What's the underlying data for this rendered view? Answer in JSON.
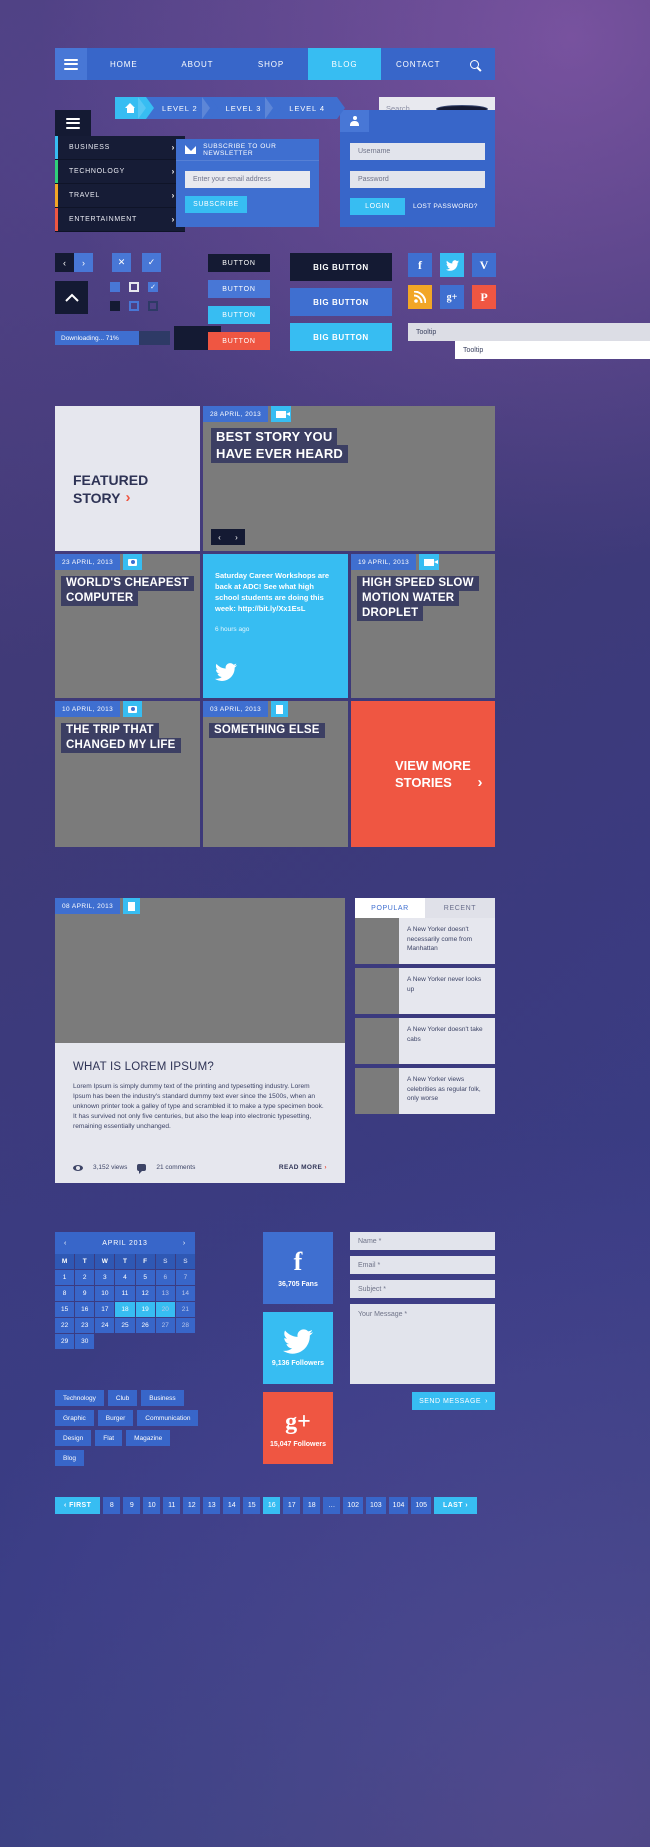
{
  "topnav": {
    "menu_icon": "hamburger-icon",
    "items": [
      {
        "label": "HOME",
        "active": false
      },
      {
        "label": "ABOUT",
        "active": false
      },
      {
        "label": "SHOP",
        "active": false
      },
      {
        "label": "BLOG",
        "active": true
      },
      {
        "label": "CONTACT",
        "active": false
      }
    ],
    "search_icon": "search-icon",
    "accent": "#37bdf2",
    "bar_color": "#3866c9"
  },
  "breadcrumb": {
    "home_icon": "home-icon",
    "items": [
      "LEVEL 2",
      "LEVEL 3",
      "LEVEL 4"
    ]
  },
  "search": {
    "placeholder": "Search...",
    "icon": "search-icon"
  },
  "sidemenu": {
    "toggle_icon": "hamburger-icon",
    "items": [
      {
        "label": "BUSINESS",
        "color": "#37bdf2"
      },
      {
        "label": "TECHNOLOGY",
        "color": "#2fd07a"
      },
      {
        "label": "TRAVEL",
        "color": "#f2a626"
      },
      {
        "label": "ENTERTAINMENT",
        "color": "#ef5642"
      }
    ],
    "chevron": "›"
  },
  "newsletter": {
    "icon": "envelope-icon",
    "title": "SUBSCRIBE TO OUR NEWSLETTER",
    "input_placeholder": "Enter your email address",
    "button": "SUBSCRIBE"
  },
  "login": {
    "tab_icon": "user-icon",
    "username_placeholder": "Username",
    "password_placeholder": "Password",
    "login_button": "LOGIN",
    "lost_password": "LOST PASSWORD?"
  },
  "controls": {
    "prev": "‹",
    "next": "›",
    "close": "✕",
    "check": "✓",
    "up": "︿",
    "progress": {
      "label": "Downloading... 71%",
      "percent": 71
    }
  },
  "buttons": {
    "small": [
      "BUTTON",
      "BUTTON",
      "BUTTON",
      "BUTTON"
    ],
    "big": [
      "BIG BUTTON",
      "BIG BUTTON",
      "BIG BUTTON"
    ]
  },
  "social_icons": [
    {
      "name": "facebook-icon",
      "glyph": "f",
      "color": "#3f6fd0"
    },
    {
      "name": "twitter-icon",
      "glyph": "t",
      "color": "#37bdf2"
    },
    {
      "name": "vimeo-icon",
      "glyph": "V",
      "color": "#3f6fd0"
    },
    {
      "name": "rss-icon",
      "glyph": "̃",
      "color": "#f2a626"
    },
    {
      "name": "googleplus-icon",
      "glyph": "g+",
      "color": "#3f6fd0"
    },
    {
      "name": "pinterest-icon",
      "glyph": "P",
      "color": "#ef5642"
    }
  ],
  "tooltips": [
    {
      "label": "Tooltip",
      "style": "grey"
    },
    {
      "label": "Tooltip",
      "style": "white"
    }
  ],
  "featured": {
    "line1": "FEATURED",
    "line2": "STORY",
    "arrow": "›"
  },
  "blog": {
    "hero": {
      "date": "28 APRIL, 2013",
      "icon": "video-icon",
      "title_line1": "BEST STORY YOU",
      "title_line2": "HAVE EVER HEARD",
      "prev": "‹",
      "next": "›"
    },
    "cards": [
      {
        "date": "23 APRIL, 2013",
        "icon": "photo-icon",
        "title_line1": "WORLD'S CHEAPEST",
        "title_line2": "COMPUTER"
      },
      {
        "date": "19 APRIL, 2013",
        "icon": "video-icon",
        "title_line1": "HIGH SPEED SLOW",
        "title_line2": "MOTION WATER",
        "title_line3": "DROPLET"
      },
      {
        "date": "10 APRIL, 2013",
        "icon": "photo-icon",
        "title_line1": "THE TRIP THAT",
        "title_line2": "CHANGED MY LIFE"
      },
      {
        "date": "03 APRIL, 2013",
        "icon": "document-icon",
        "title_line1": "SOMETHING ELSE"
      }
    ],
    "tweet": {
      "text": "Saturday Career Workshops are back at ADC! See what high school students are doing this week: http://bit.ly/Xx1EsL",
      "ago": "6 hours ago",
      "icon": "twitter-icon"
    },
    "view_more": {
      "line1": "VIEW MORE",
      "line2": "STORIES",
      "arrow": "›",
      "color": "#ef5642"
    }
  },
  "article": {
    "date": "08 APRIL, 2013",
    "icon": "document-icon",
    "title": "WHAT IS LOREM IPSUM?",
    "body": "Lorem Ipsum is simply dummy text of the printing and typesetting industry. Lorem Ipsum has been the industry's standard dummy text ever since the 1500s, when an unknown printer took a galley of type and scrambled it to make a type specimen book. It has survived not only five centuries, but also the leap into electronic typesetting, remaining essentially unchanged.",
    "views": "3,152 views",
    "views_icon": "eye-icon",
    "comments": "21 comments",
    "comments_icon": "comment-icon",
    "read_more": "READ MORE",
    "read_more_arrow": "›"
  },
  "tabs_widget": {
    "tabs": [
      {
        "label": "POPULAR",
        "active": true
      },
      {
        "label": "RECENT",
        "active": false
      }
    ],
    "rows": [
      "A New Yorker doesn't necessarily come from Manhattan",
      "A New Yorker never looks up",
      "A New Yorker doesn't take cabs",
      "A New Yorker views celebrities as regular folk, only worse"
    ]
  },
  "calendar": {
    "title": "APRIL 2013",
    "prev": "‹",
    "next": "›",
    "daynames": [
      "M",
      "T",
      "W",
      "T",
      "F",
      "S",
      "S"
    ],
    "leading_blanks": 0,
    "days": [
      1,
      2,
      3,
      4,
      5,
      6,
      7,
      8,
      9,
      10,
      11,
      12,
      13,
      14,
      15,
      16,
      17,
      18,
      19,
      20,
      21,
      22,
      23,
      24,
      25,
      26,
      27,
      28,
      29,
      30
    ],
    "selected": [
      18,
      19,
      20
    ]
  },
  "tags": [
    "Technology",
    "Club",
    "Business",
    "Graphic",
    "Burger",
    "Communication",
    "Design",
    "Flat",
    "Magazine",
    "Blog"
  ],
  "social_boxes": [
    {
      "name": "facebook-box",
      "glyph": "f",
      "count": "36,705 Fans",
      "color": "#3f6fd0"
    },
    {
      "name": "twitter-box",
      "glyph": "t",
      "count": "9,136 Followers",
      "color": "#37bdf2"
    },
    {
      "name": "googleplus-box",
      "glyph": "g+",
      "count": "15,047 Followers",
      "color": "#ef5642"
    }
  ],
  "contact_form": {
    "name": "Name *",
    "email": "Email *",
    "subject": "Subject *",
    "message": "Your Message *",
    "send": "SEND MESSAGE",
    "send_arrow": "›"
  },
  "pagination": {
    "first": "FIRST",
    "first_arrow": "‹",
    "pages": [
      "8",
      "9",
      "10",
      "11",
      "12",
      "13",
      "14",
      "15",
      "16",
      "17",
      "18",
      "…",
      "102",
      "103",
      "104",
      "105"
    ],
    "active": "16",
    "last": "LAST",
    "last_arrow": "›"
  }
}
